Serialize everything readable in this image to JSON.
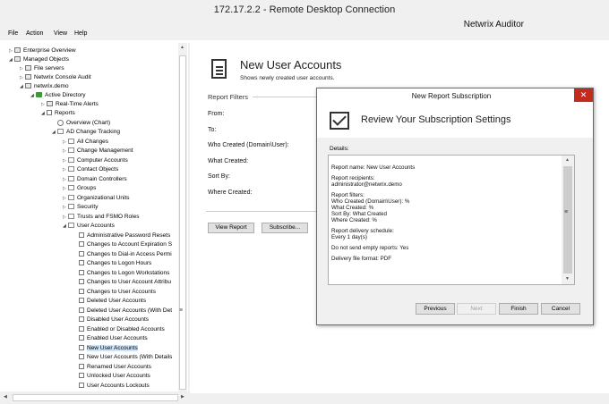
{
  "rdp": {
    "title": "172.17.2.2 - Remote Desktop Connection"
  },
  "app": {
    "title": "Netwrix Auditor"
  },
  "menu": {
    "file": "File",
    "action": "Action",
    "view": "View",
    "help": "Help"
  },
  "tree": {
    "enterprise_overview": "Enterprise Overview",
    "managed_objects": "Managed Objects",
    "file_servers": "File servers",
    "console_audit": "Netwrix Console Audit",
    "netwrix_demo": "netwrix.demo",
    "active_directory": "Active Directory",
    "realtime_alerts": "Real-Time Alerts",
    "reports": "Reports",
    "overview_chart": "Overview (Chart)",
    "ad_change_tracking": "AD Change Tracking",
    "folders": [
      "All Changes",
      "Change Management",
      "Computer Accounts",
      "Contact Objects",
      "Domain Controllers",
      "Groups",
      "Organizational Units",
      "Security",
      "Trusts and FSMO Roles",
      "User Accounts"
    ],
    "user_account_reports": [
      "Administrative Password Resets",
      "Changes to Account Expiration S",
      "Changes to Dial-in Access Permi",
      "Changes to Logon Hours",
      "Changes to Logon Workstations",
      "Changes to User Account Attribu",
      "Changes to User Accounts",
      "Deleted User Accounts",
      "Deleted User Accounts (With Det",
      "Disabled User Accounts",
      "Enabled or Disabled Accounts",
      "Enabled User Accounts",
      "New User Accounts",
      "New User Accounts (With Details",
      "Renamed User Accounts",
      "Unlocked User Accounts",
      "User Accounts Lockouts"
    ],
    "selected_report": "New User Accounts"
  },
  "report": {
    "title": "New User Accounts",
    "subtitle": "Shows newly created user accounts.",
    "filters_label": "Report Filters",
    "fields": {
      "from": "From:",
      "to": "To:",
      "who_created": "Who Created (Domain\\User):",
      "what_created": "What Created:",
      "sort_by": "Sort By:",
      "where_created": "Where Created:"
    },
    "view_report_button": "View Report",
    "subscribe_button": "Subscribe..."
  },
  "dialog": {
    "title": "New Report Subscription",
    "close_glyph": "✕",
    "heading": "Review Your Subscription Settings",
    "details_label": "Details:",
    "details": {
      "report_name": "Report name: New User Accounts",
      "recipients_label": "Report recipients:",
      "recipients_value": "administrator@netwrix.demo",
      "filters_label": "Report filters:",
      "filter_who": "Who Created (Domain\\User):  %",
      "filter_what": "What Created: %",
      "filter_sort": "Sort By: What Created",
      "filter_where": "Where Created: %",
      "schedule_label": "Report delivery schedule:",
      "schedule_value": "Every 1 day(s)",
      "empty_reports": "Do not send empty reports: Yes",
      "format": "Delivery file format: PDF"
    },
    "buttons": {
      "previous": "Previous",
      "next": "Next",
      "finish": "Finish",
      "cancel": "Cancel"
    }
  }
}
